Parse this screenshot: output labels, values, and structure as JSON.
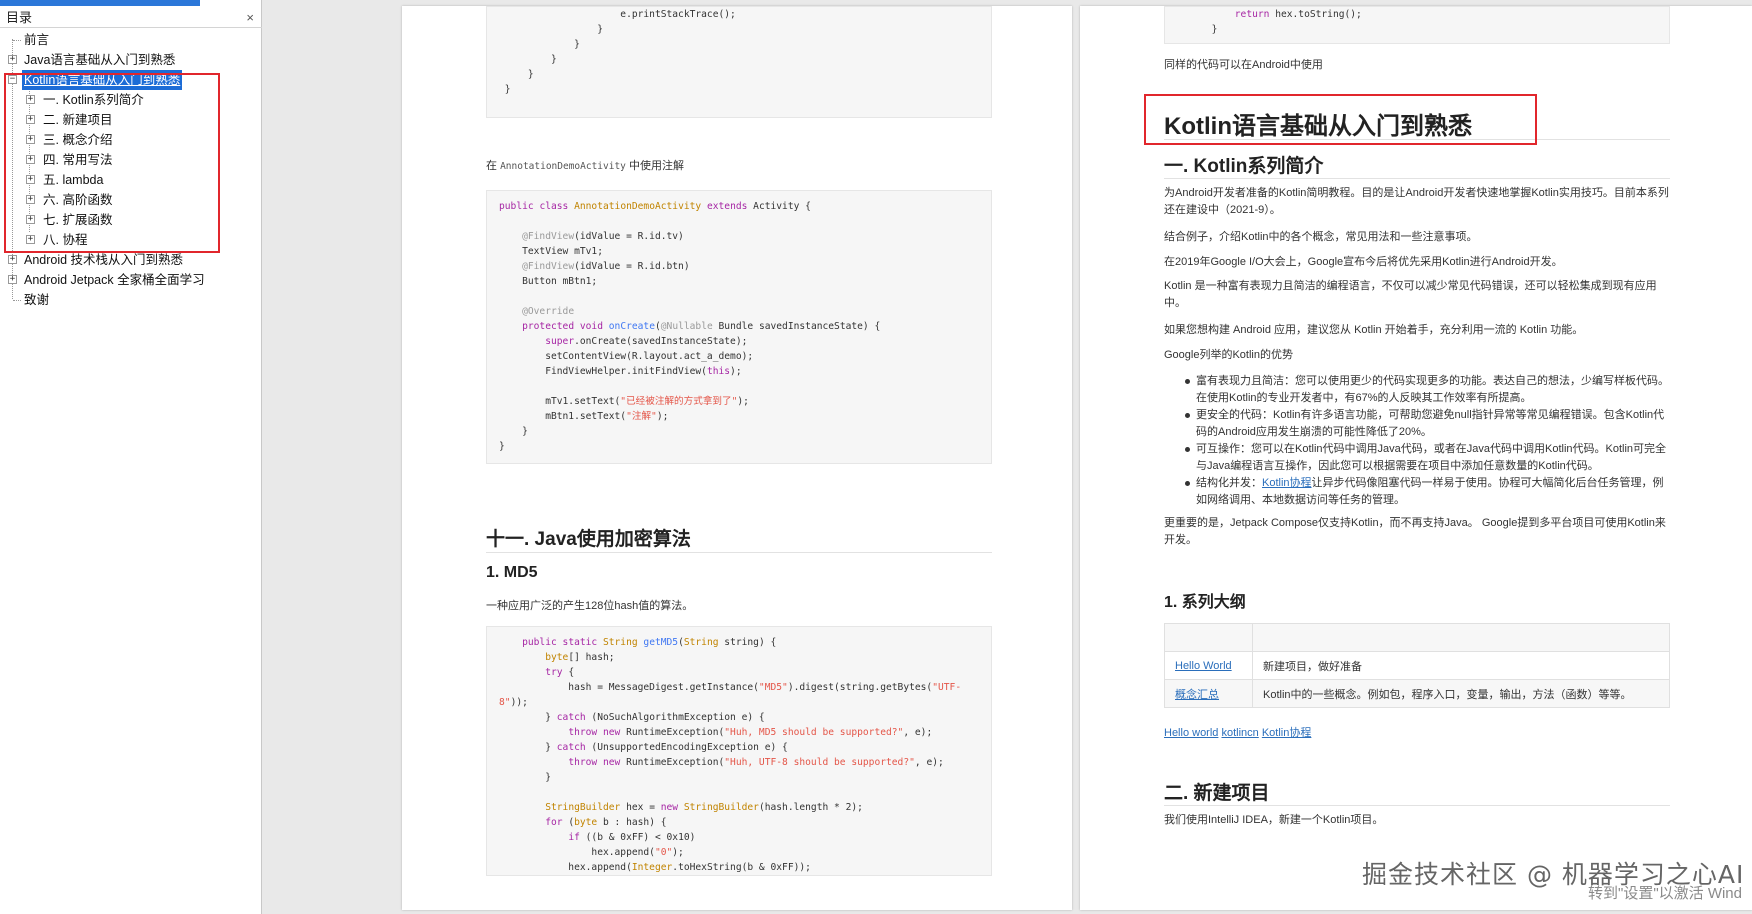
{
  "sidebar": {
    "title": "目录",
    "close_glyph": "×",
    "items": {
      "preface": "前言",
      "java": "Java语言基础从入门到熟悉",
      "kotlin": "Kotlin语言基础从入门到熟悉",
      "k1": "一. Kotlin系列简介",
      "k2": "二. 新建项目",
      "k3": "三. 概念介绍",
      "k4": "四. 常用写法",
      "k5": "五. lambda",
      "k6": "六. 高阶函数",
      "k7": "七. 扩展函数",
      "k8": "八. 协程",
      "android": "Android 技术栈从入门到熟悉",
      "jetpack": "Android Jetpack 全家桶全面学习",
      "thanks": "致谢"
    }
  },
  "page1": {
    "annot_text_pre": "在 ",
    "annot_class": "AnnotationDemoActivity",
    "annot_text_post": " 中使用注解",
    "heading11": "十一. Java使用加密算法",
    "heading_md5": "1. MD5",
    "md5_desc": "一种应用广泛的产生128位hash值的算法。"
  },
  "page2": {
    "same_code_note": "同样的代码可以在Android中使用",
    "title": "Kotlin语言基础从入门到熟悉",
    "section1": "一. Kotlin系列简介",
    "p1": "为Android开发者准备的Kotlin简明教程。目的是让Android开发者快速地掌握Kotlin实用技巧。目前本系列还在建设中（2021-9）。",
    "p2": "结合例子，介绍Kotlin中的各个概念，常见用法和一些注意事项。",
    "p3": "在2019年Google I/O大会上，Google宣布今后将优先采用Kotlin进行Android开发。",
    "p4": "Kotlin 是一种富有表现力且简洁的编程语言，不仅可以减少常见代码错误，还可以轻松集成到现有应用中。",
    "p5": "如果您想构建 Android 应用，建议您从 Kotlin 开始着手，充分利用一流的 Kotlin 功能。",
    "p6": "Google列举的Kotlin的优势",
    "bullets": {
      "b1": "富有表现力且简洁：您可以使用更少的代码实现更多的功能。表达自己的想法，少编写样板代码。在使用Kotlin的专业开发者中，有67%的人反映其工作效率有所提高。",
      "b2": "更安全的代码：Kotlin有许多语言功能，可帮助您避免null指针异常等常见编程错误。包含Kotlin代码的Android应用发生崩溃的可能性降低了20%。",
      "b3": "可互操作：您可以在Kotlin代码中调用Java代码，或者在Java代码中调用Kotlin代码。Kotlin可完全与Java编程语言互操作，因此您可以根据需要在项目中添加任意数量的Kotlin代码。",
      "b4_pre": "结构化并发：",
      "b4_link": "Kotlin协程",
      "b4_post": "让异步代码像阻塞代码一样易于使用。协程可大幅简化后台任务管理，例如网络调用、本地数据访问等任务的管理。"
    },
    "p7": "更重要的是，Jetpack Compose仅支持Kotlin，而不再支持Java。 Google提到多平台项目可使用Kotlin来开发。",
    "outline_heading": "1. 系列大纲",
    "table": {
      "r1_link": "Hello World",
      "r1_text": "新建项目，做好准备",
      "r2_link": "概念汇总",
      "r2_text": "Kotlin中的一些概念。例如包，程序入口，变量，输出，方法（函数）等等。"
    },
    "links": {
      "l1": "Hello world",
      "l2": "kotlincn",
      "l3": "Kotlin协程"
    },
    "section2": "二. 新建项目",
    "p8": "我们使用IntelliJ IDEA，新建一个Kotlin项目。"
  },
  "overlay": {
    "watermark": "掘金技术社区 @ 机器学习之心AI",
    "activate": "转到\"设置\"以激活 Wind"
  },
  "colors": {
    "accent": "#1c6cd6",
    "highlight_box": "#e1262c"
  }
}
